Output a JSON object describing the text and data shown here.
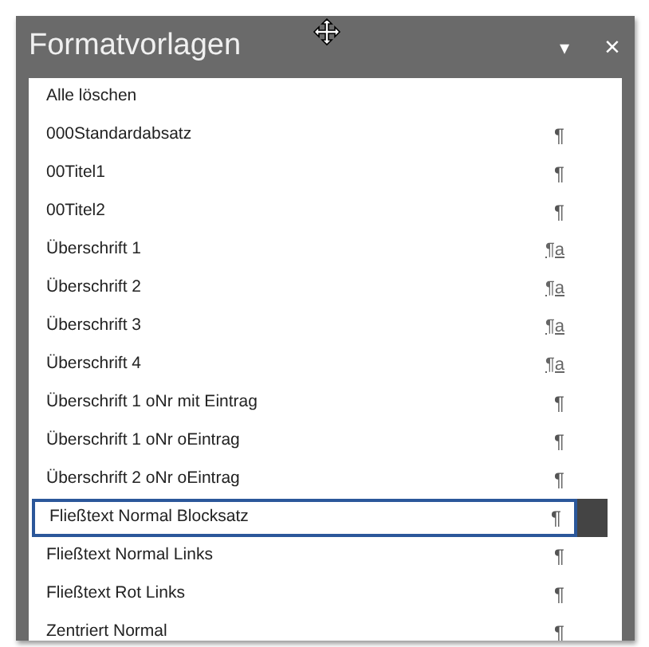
{
  "panel": {
    "title": "Formatvorlagen",
    "menu_arrow": "▾",
    "close": "×"
  },
  "styles": [
    {
      "name": "Alle löschen",
      "kind": "command",
      "selected": false
    },
    {
      "name": "000Standardabsatz",
      "kind": "paragraph",
      "symbol": "¶",
      "selected": false
    },
    {
      "name": "00Titel1",
      "kind": "paragraph",
      "symbol": "¶",
      "selected": false
    },
    {
      "name": "00Titel2",
      "kind": "paragraph",
      "symbol": "¶",
      "selected": false
    },
    {
      "name": "Überschrift 1",
      "kind": "linked",
      "symbol": "¶a",
      "selected": false
    },
    {
      "name": "Überschrift 2",
      "kind": "linked",
      "symbol": "¶a",
      "selected": false
    },
    {
      "name": "Überschrift 3",
      "kind": "linked",
      "symbol": "¶a",
      "selected": false
    },
    {
      "name": "Überschrift 4",
      "kind": "linked",
      "symbol": "¶a",
      "selected": false
    },
    {
      "name": "Überschrift 1 oNr mit Eintrag",
      "kind": "paragraph",
      "symbol": "¶",
      "selected": false
    },
    {
      "name": "Überschrift 1 oNr oEintrag",
      "kind": "paragraph",
      "symbol": "¶",
      "selected": false
    },
    {
      "name": "Überschrift 2 oNr oEintrag",
      "kind": "paragraph",
      "symbol": "¶",
      "selected": false
    },
    {
      "name": "Fließtext Normal Blocksatz",
      "kind": "paragraph",
      "symbol": "¶",
      "selected": true
    },
    {
      "name": "Fließtext Normal Links",
      "kind": "paragraph",
      "symbol": "¶",
      "selected": false
    },
    {
      "name": "Fließtext Rot Links",
      "kind": "paragraph",
      "symbol": "¶",
      "selected": false
    },
    {
      "name": "Zentriert Normal",
      "kind": "paragraph",
      "symbol": "¶",
      "selected": false
    }
  ]
}
